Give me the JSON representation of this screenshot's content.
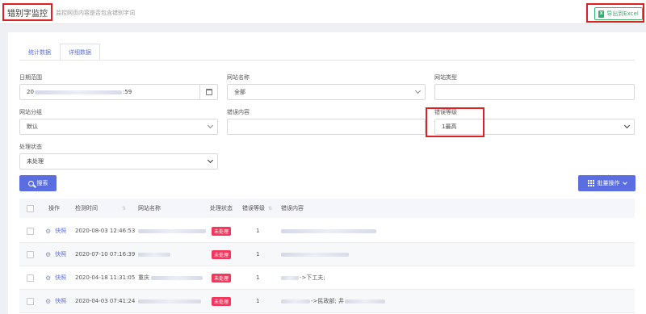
{
  "header": {
    "title": "错别字监控",
    "subtitle": "监控网页内容是否包含错别字词",
    "export_label": "导出到Excel"
  },
  "tabs": [
    "统计数据",
    "详细数据"
  ],
  "filters": {
    "date_range": {
      "label": "日期范围",
      "value_prefix": "20",
      "value_suffix": ":59"
    },
    "site_name": {
      "label": "网站名称",
      "value": "全部"
    },
    "site_type": {
      "label": "网站类型",
      "value": ""
    },
    "site_group": {
      "label": "网站分组",
      "value": "默认"
    },
    "error_content": {
      "label": "错误内容",
      "value": ""
    },
    "error_level": {
      "label": "错误等级",
      "value": "1最高"
    },
    "status": {
      "label": "处理状态",
      "value": "未处理"
    }
  },
  "actions": {
    "search_label": "搜索",
    "batch_label": "批量操作"
  },
  "table": {
    "headers": [
      "操作",
      "检测时间",
      "网站名称",
      "处理状态",
      "错误等级",
      "错误内容"
    ],
    "action_label": "快照",
    "rows": [
      {
        "time": "2020-08-03 12:46:53",
        "site": "",
        "status": "未处理",
        "level": "1",
        "content": ""
      },
      {
        "time": "2020-07-10 07:16:39",
        "site": "",
        "status": "未处理",
        "level": "1",
        "content": ""
      },
      {
        "time": "2020-04-18 11:31:05",
        "site": "重庆",
        "status": "未处理",
        "level": "1",
        "content": "->下工夫;"
      },
      {
        "time": "2020-04-03 07:41:24",
        "site": "",
        "status": "未处理",
        "level": "1",
        "content": "->民政部; 井"
      }
    ]
  },
  "colors": {
    "accent": "#5b6ee1",
    "badge": "#f5365c",
    "excel_green": "#2db36b",
    "highlight_red": "#e02020"
  },
  "icons": [
    "excel-icon",
    "calendar-icon",
    "chevron-down-icon",
    "search-icon",
    "grid-icon",
    "gear-icon",
    "sort-icon"
  ]
}
